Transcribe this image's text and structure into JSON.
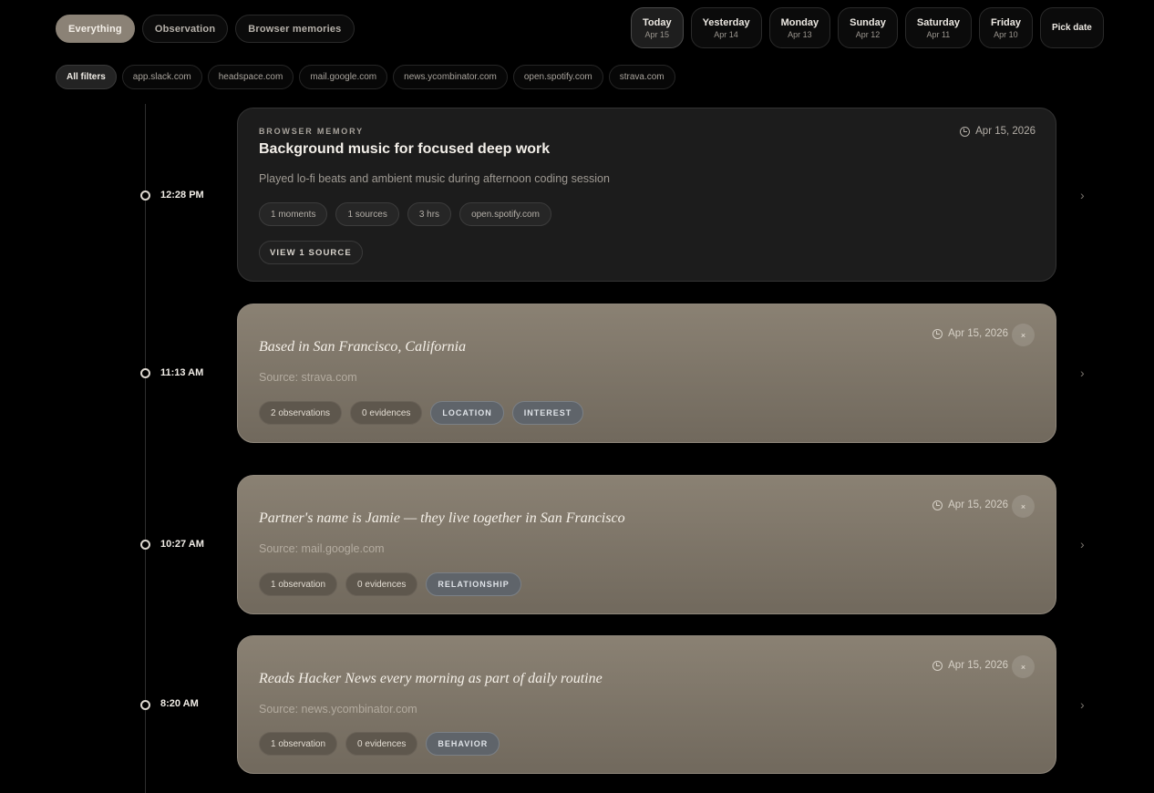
{
  "type_tabs": [
    {
      "label": "Everything",
      "active": true
    },
    {
      "label": "Observation",
      "active": false
    },
    {
      "label": "Browser memories",
      "active": false
    }
  ],
  "date_tabs": [
    {
      "day": "Today",
      "date": "Apr 15",
      "active": true
    },
    {
      "day": "Yesterday",
      "date": "Apr 14",
      "active": false
    },
    {
      "day": "Monday",
      "date": "Apr 13",
      "active": false
    },
    {
      "day": "Sunday",
      "date": "Apr 12",
      "active": false
    },
    {
      "day": "Saturday",
      "date": "Apr 11",
      "active": false
    },
    {
      "day": "Friday",
      "date": "Apr 10",
      "active": false
    },
    {
      "day": "Pick date",
      "date": "",
      "active": false
    }
  ],
  "filters": [
    {
      "label": "All filters",
      "active": true
    },
    {
      "label": "app.slack.com",
      "active": false
    },
    {
      "label": "headspace.com",
      "active": false
    },
    {
      "label": "mail.google.com",
      "active": false
    },
    {
      "label": "news.ycombinator.com",
      "active": false
    },
    {
      "label": "open.spotify.com",
      "active": false
    },
    {
      "label": "strava.com",
      "active": false
    }
  ],
  "timeline": [
    {
      "time": "12:28 PM",
      "kind": "memory",
      "eyebrow": "BROWSER MEMORY",
      "title": "Background music for focused deep work",
      "description": "Played lo-fi beats and ambient music during afternoon coding session",
      "date": "Apr 15, 2026",
      "chips": [
        "1 moments",
        "1 sources",
        "3 hrs",
        "open.spotify.com"
      ],
      "action_label": "VIEW 1 SOURCE"
    },
    {
      "time": "11:13 AM",
      "kind": "observation",
      "title": "Based in San Francisco, California",
      "source": "Source: strava.com",
      "date": "Apr 15, 2026",
      "close_label": "×",
      "chips": [
        "2 observations",
        "0 evidences"
      ],
      "tags": [
        "LOCATION",
        "INTEREST"
      ]
    },
    {
      "time": "10:27 AM",
      "kind": "observation",
      "title": "Partner's name is Jamie — they live together in San Francisco",
      "source": "Source: mail.google.com",
      "date": "Apr 15, 2026",
      "close_label": "×",
      "chips": [
        "1 observation",
        "0 evidences"
      ],
      "tags": [
        "RELATIONSHIP"
      ]
    },
    {
      "time": "8:20 AM",
      "kind": "observation",
      "title": "Reads Hacker News every morning as part of daily routine",
      "source": "Source: news.ycombinator.com",
      "date": "Apr 15, 2026",
      "close_label": "×",
      "chips": [
        "1 observation",
        "0 evidences"
      ],
      "tags": [
        "BEHAVIOR"
      ]
    }
  ],
  "icons": {
    "clock": "clock-icon",
    "chevron": "chevron-right-icon",
    "close": "close-icon"
  },
  "colors": {
    "background": "#000000",
    "accent": "#8b8276",
    "observation_card": "#7f776a",
    "memory_card": "#1c1c1c"
  }
}
